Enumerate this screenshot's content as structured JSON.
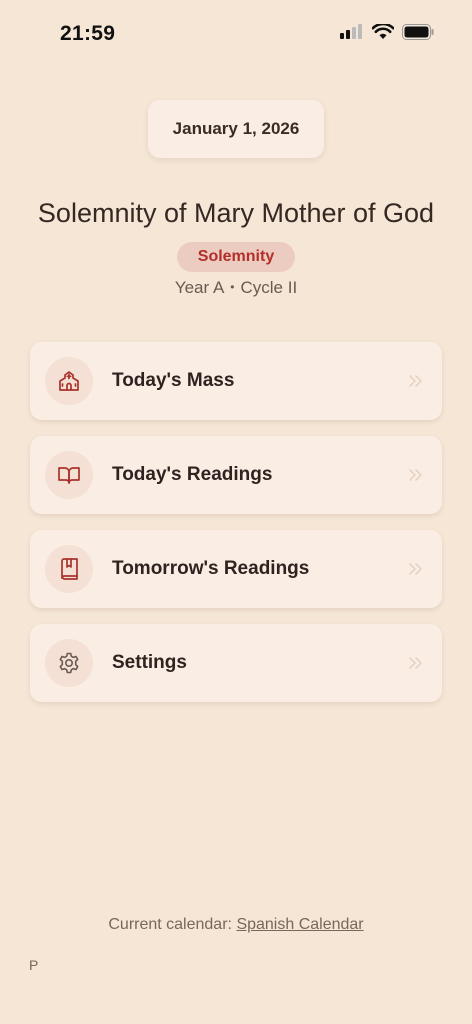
{
  "status_bar": {
    "time": "21:59"
  },
  "header": {
    "date": "January 1, 2026",
    "feast_title": "Solemnity of Mary Mother of God",
    "rank": "Solemnity",
    "year": "Year A",
    "separator": "•",
    "cycle": "Cycle II"
  },
  "menu": {
    "items": [
      {
        "label": "Today's Mass",
        "icon": "church-icon"
      },
      {
        "label": "Today's Readings",
        "icon": "open-book-icon"
      },
      {
        "label": "Tomorrow's Readings",
        "icon": "bookmark-book-icon"
      },
      {
        "label": "Settings",
        "icon": "gear-icon"
      }
    ]
  },
  "footer": {
    "prefix": "Current calendar:",
    "calendar_link": "Spanish Calendar",
    "corner_letter": "P"
  },
  "colors": {
    "background": "#f5e6d6",
    "card": "#faeee4",
    "accent_red": "#b3302a",
    "badge_bg": "#ecccc0"
  }
}
